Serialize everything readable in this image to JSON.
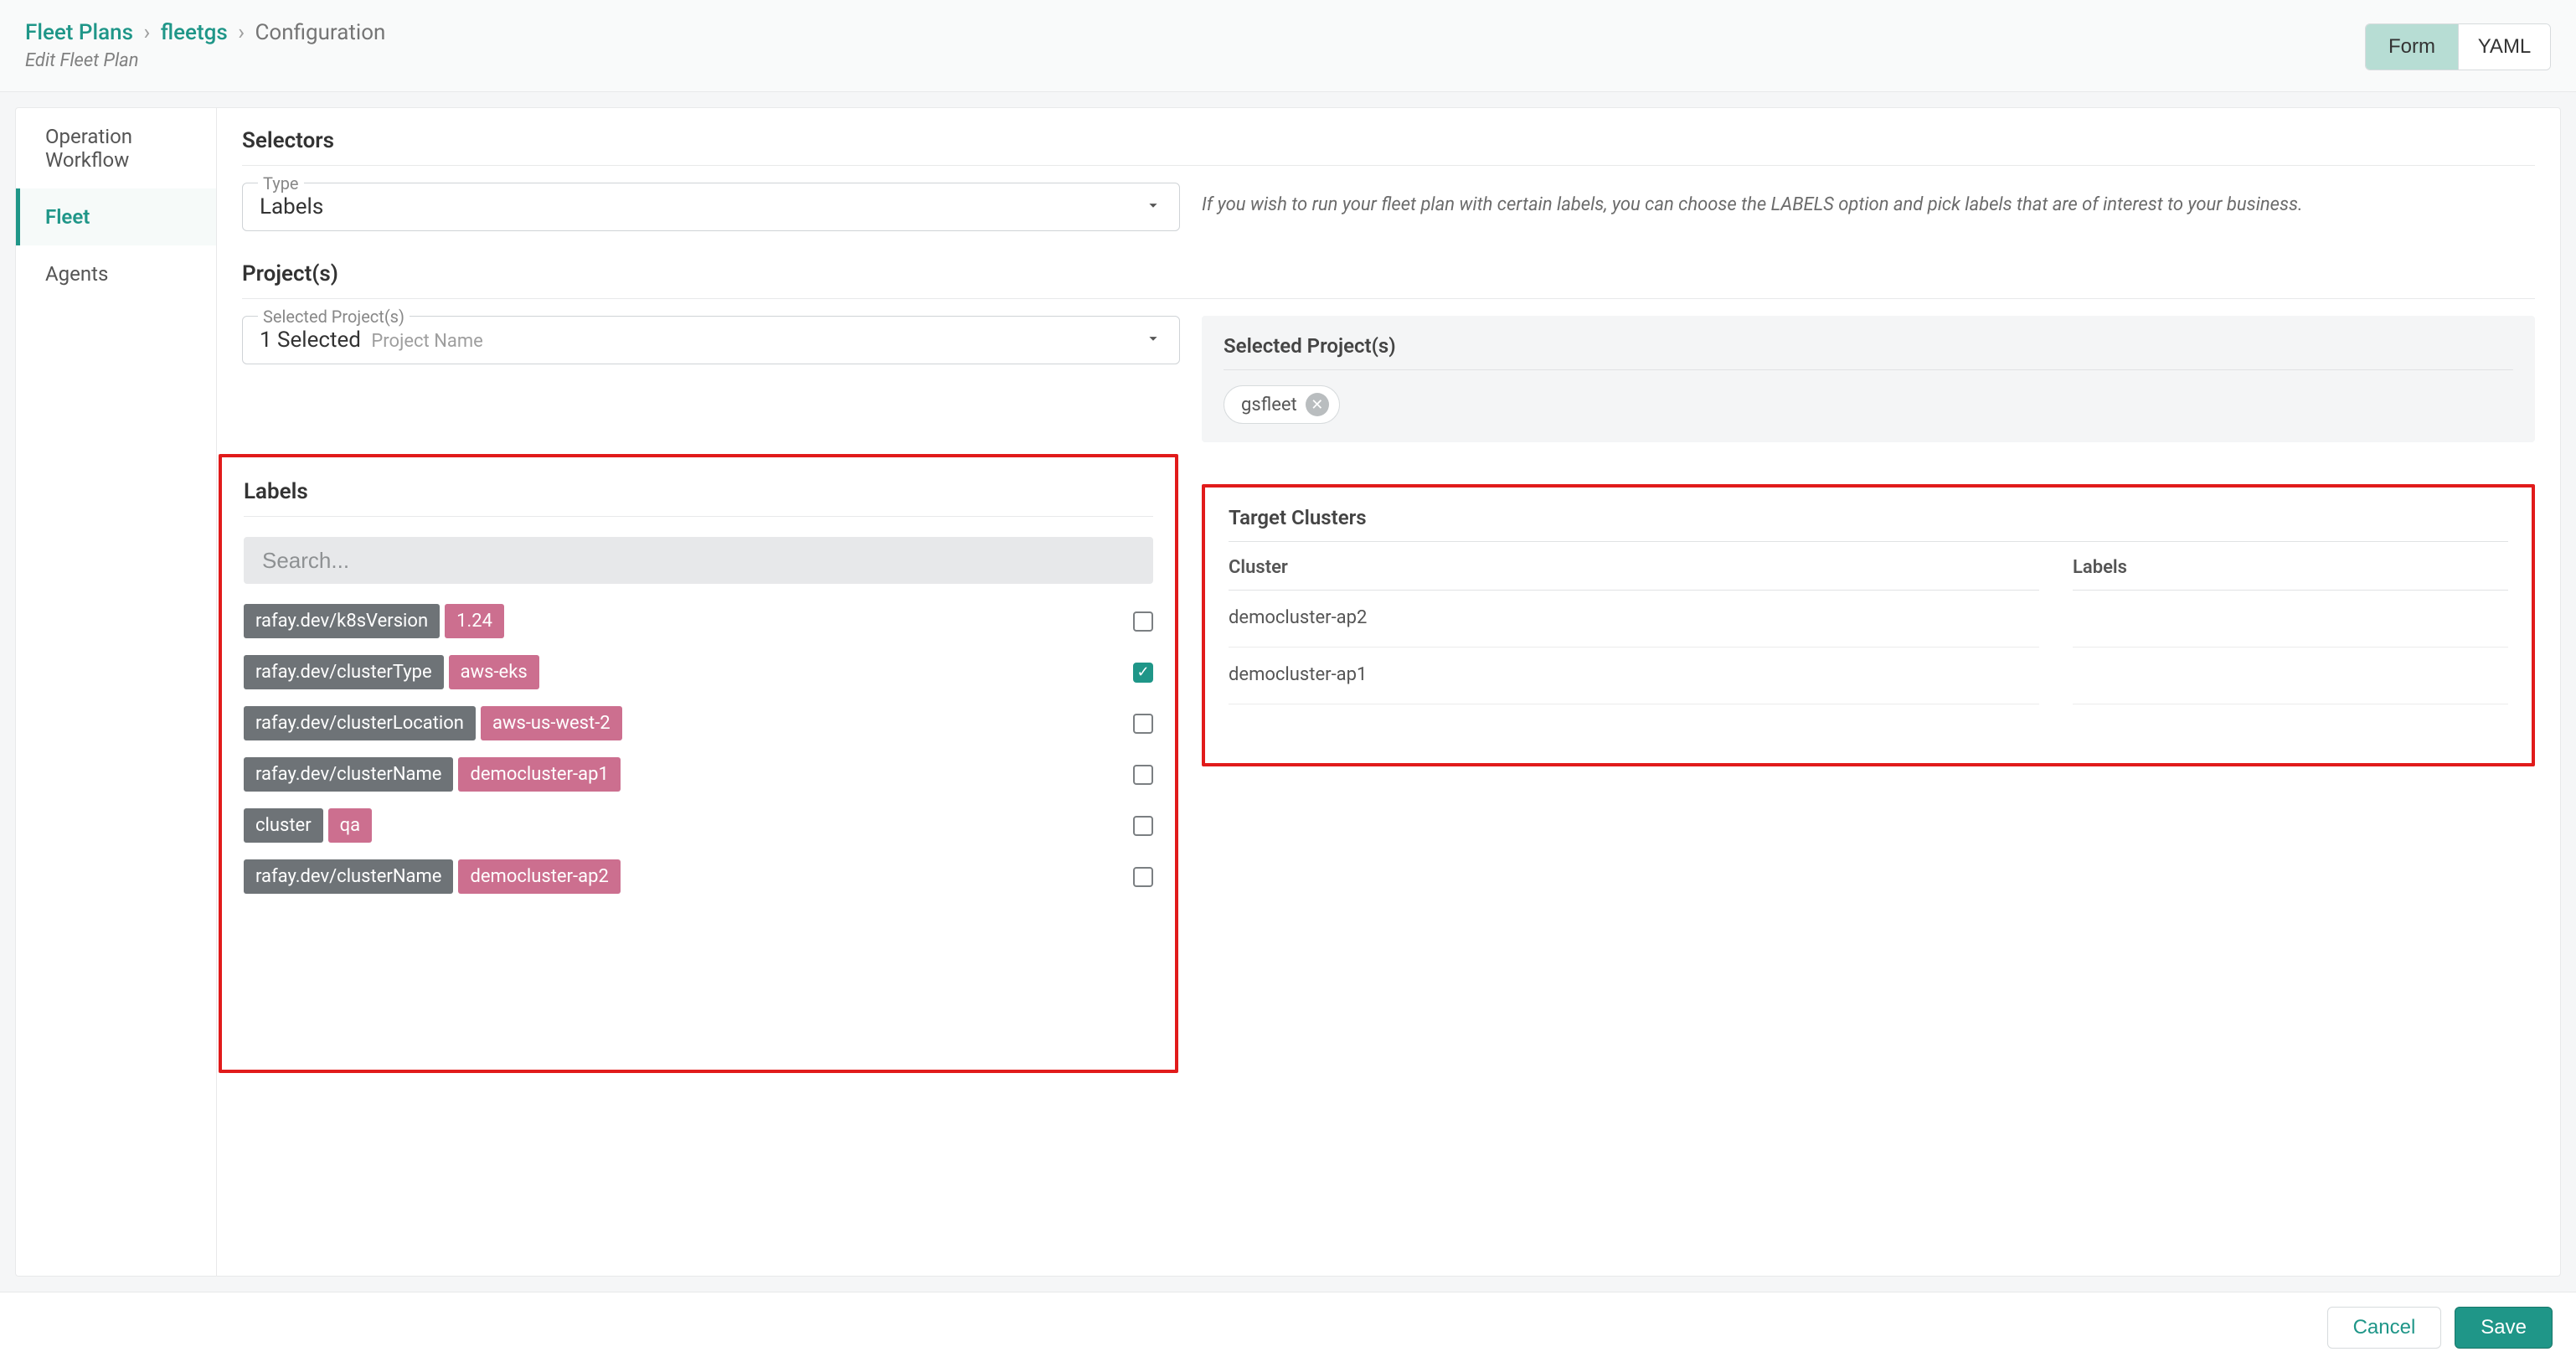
{
  "breadcrumb": {
    "root": "Fleet Plans",
    "item": "fleetgs",
    "leaf": "Configuration"
  },
  "subtitle": "Edit Fleet Plan",
  "viewToggle": {
    "form": "Form",
    "yaml": "YAML"
  },
  "sidebar": {
    "items": [
      {
        "label": "Operation Workflow"
      },
      {
        "label": "Fleet"
      },
      {
        "label": "Agents"
      }
    ]
  },
  "selectors": {
    "title": "Selectors",
    "type": {
      "label": "Type",
      "value": "Labels"
    },
    "helper": "If you wish to run your fleet plan with certain labels, you can choose the LABELS option and pick labels that are of interest to your business."
  },
  "projects": {
    "title": "Project(s)",
    "select": {
      "label": "Selected Project(s)",
      "value": "1 Selected",
      "hint": "Project Name"
    },
    "panelTitle": "Selected Project(s)",
    "chips": [
      {
        "name": "gsfleet"
      }
    ]
  },
  "labels": {
    "title": "Labels",
    "searchPlaceholder": "Search...",
    "rows": [
      {
        "key": "rafay.dev/k8sVersion",
        "val": "1.24",
        "checked": false
      },
      {
        "key": "rafay.dev/clusterType",
        "val": "aws-eks",
        "checked": true
      },
      {
        "key": "rafay.dev/clusterLocation",
        "val": "aws-us-west-2",
        "checked": false
      },
      {
        "key": "rafay.dev/clusterName",
        "val": "democluster-ap1",
        "checked": false
      },
      {
        "key": "cluster",
        "val": "qa",
        "checked": false
      },
      {
        "key": "rafay.dev/clusterName",
        "val": "democluster-ap2",
        "checked": false
      }
    ]
  },
  "targetClusters": {
    "title": "Target Clusters",
    "columns": {
      "cluster": "Cluster",
      "labels": "Labels"
    },
    "rows": [
      {
        "cluster": "democluster-ap2",
        "labels": ""
      },
      {
        "cluster": "democluster-ap1",
        "labels": ""
      }
    ]
  },
  "footer": {
    "cancel": "Cancel",
    "save": "Save"
  }
}
